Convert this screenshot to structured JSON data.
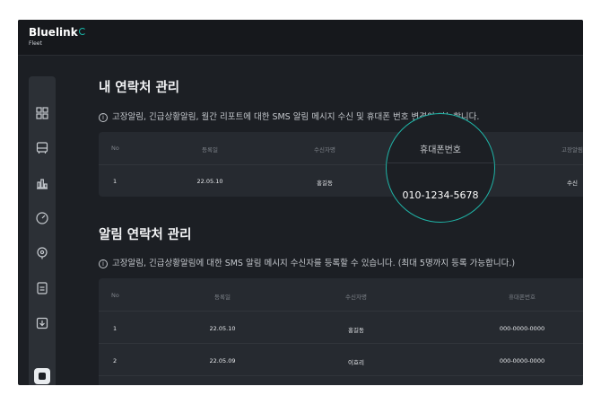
{
  "brand": {
    "name": "Bluelink",
    "sub": "Fleet"
  },
  "sidebar": {
    "icons": [
      "grid-icon",
      "bus-icon",
      "bar-chart-icon",
      "gauge-icon",
      "location-pin-icon",
      "document-icon",
      "download-icon",
      "settings-icon"
    ]
  },
  "my_contact": {
    "title": "내 연락처 관리",
    "info": "고장알림, 긴급상황알림, 월간 리포트에 대한 SMS 알림 메시지 수신 및 휴대폰 번호 변경이 가능합니다.",
    "columns": [
      "No",
      "등록일",
      "수신자명",
      "휴대폰번호",
      "고장알림"
    ],
    "rows": [
      {
        "no": "1",
        "date": "22.05.10",
        "name": "홍길동",
        "phone": "010-1234-5678",
        "fault": "수신"
      }
    ]
  },
  "alert_contact": {
    "title": "알림 연락처 관리",
    "info": "고장알림, 긴급상황알림에 대한 SMS 알림 메시지 수신자를 등록할 수 있습니다. (최대 5명까지 등록 가능합니다.)",
    "columns": [
      "No",
      "등록일",
      "수신자명",
      "휴대폰번호"
    ],
    "rows": [
      {
        "no": "1",
        "date": "22.05.10",
        "name": "홍길동",
        "phone": "000-0000-0000"
      },
      {
        "no": "2",
        "date": "22.05.09",
        "name": "이효리",
        "phone": "000-0000-0000"
      }
    ]
  }
}
